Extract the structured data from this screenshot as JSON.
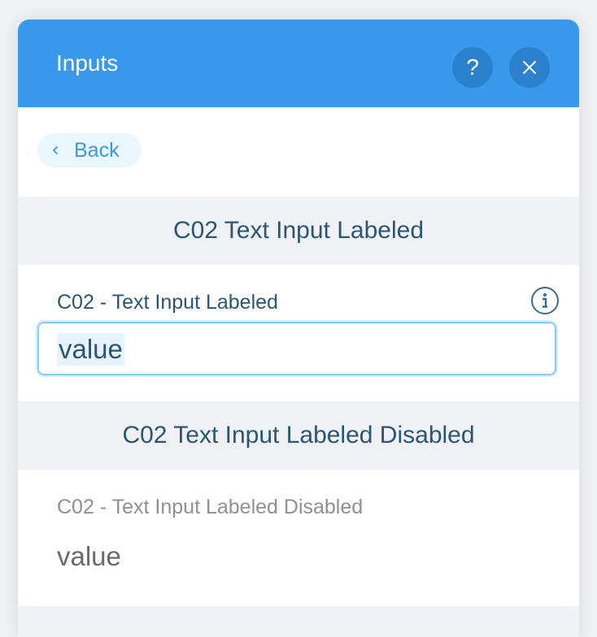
{
  "panel": {
    "title": "Inputs",
    "help_label": "?",
    "back_label": "Back"
  },
  "sections": [
    {
      "header": "C02 Text Input Labeled",
      "field_label": "C02 - Text Input Labeled",
      "value": "value"
    },
    {
      "header": "C02 Text Input Labeled Disabled",
      "field_label": "C02 - Text Input Labeled Disabled",
      "value": "value"
    }
  ],
  "colors": {
    "header_bg": "#3899ec",
    "header_button_bg": "#2b81cb",
    "text_primary": "#2b5672",
    "section_bg": "#f0f1f4",
    "disabled_text": "#909090"
  },
  "icons": {
    "help": "help-icon",
    "close": "close-icon",
    "back": "chevron-left-icon",
    "info": "info-icon"
  }
}
